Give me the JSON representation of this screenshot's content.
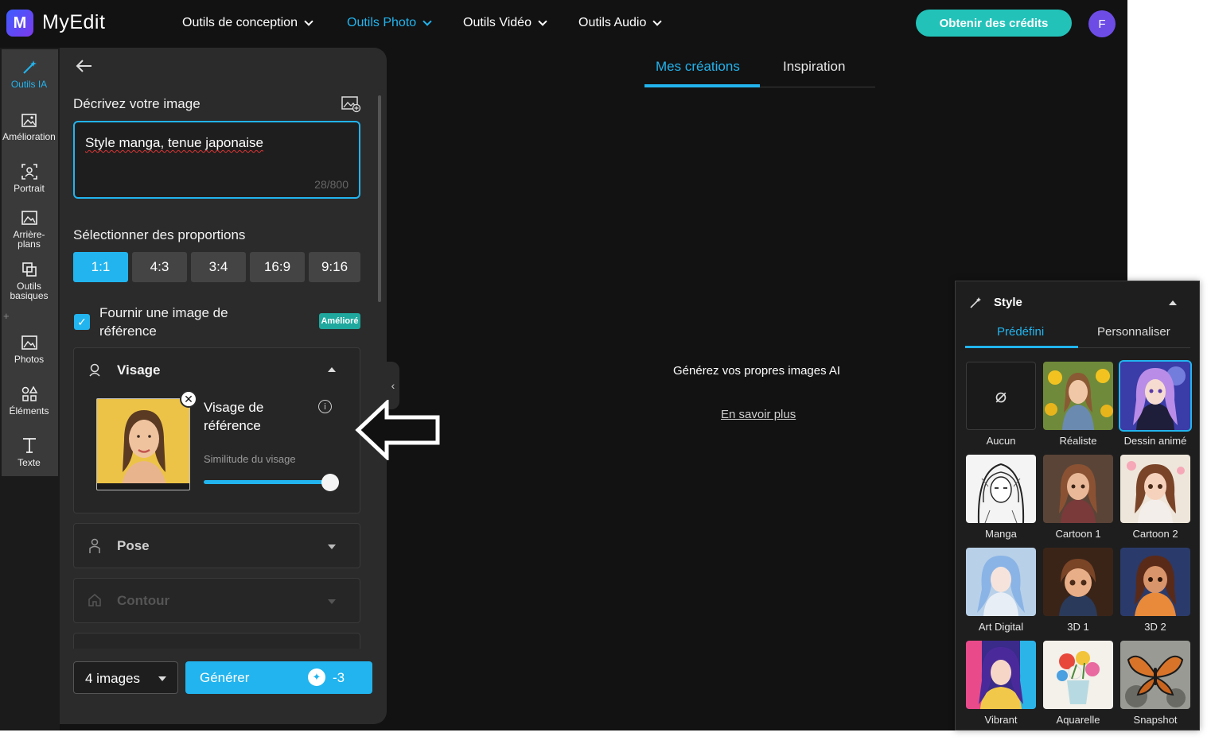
{
  "app": {
    "name": "MyEdit",
    "logo_letter": "M"
  },
  "nav": [
    {
      "label": "Outils de conception"
    },
    {
      "label": "Outils Photo"
    },
    {
      "label": "Outils Vidéo"
    },
    {
      "label": "Outils Audio"
    }
  ],
  "header": {
    "credits_button": "Obtenir des crédits",
    "avatar_letter": "F"
  },
  "sidebar": {
    "items": [
      {
        "label": "Outils IA",
        "icon": "magic-wand-icon"
      },
      {
        "label": "Amélioration",
        "icon": "image-enhance-icon"
      },
      {
        "label": "Portrait",
        "icon": "portrait-icon"
      },
      {
        "label": "Arrière-plans",
        "icon": "background-icon"
      },
      {
        "label": "Outils basiques",
        "icon": "crop-icon"
      },
      {
        "label": "Photos",
        "icon": "photo-icon"
      },
      {
        "label": "Éléments",
        "icon": "elements-icon"
      },
      {
        "label": "Texte",
        "icon": "text-icon"
      }
    ]
  },
  "panel": {
    "describe_label": "Décrivez votre image",
    "prompt_value": "Style manga, tenue japonaise",
    "char_count": "28/800",
    "proportions_label": "Sélectionner des proportions",
    "ratios": [
      "1:1",
      "4:3",
      "3:4",
      "16:9",
      "9:16"
    ],
    "selected_ratio": "1:1",
    "reference_checkbox_label": "Fournir une image de référence",
    "reference_checked": true,
    "improved_badge": "Amélioré",
    "face_section": {
      "title": "Visage",
      "ref_title": "Visage de référence",
      "similarity_label": "Similitude du visage",
      "similarity_value": 0.9
    },
    "pose_section": {
      "title": "Pose"
    },
    "contour_section": {
      "title": "Contour"
    },
    "images_count": "4 images",
    "generate_button": "Générer",
    "generate_cost": "-3"
  },
  "main": {
    "tabs": [
      "Mes créations",
      "Inspiration"
    ],
    "active_tab": "Mes créations",
    "empty_message": "Générez vos propres images AI",
    "learn_more": "En savoir plus"
  },
  "style_panel": {
    "title": "Style",
    "tabs": [
      "Prédéfini",
      "Personnaliser"
    ],
    "active_tab": "Prédéfini",
    "styles": [
      {
        "label": "Aucun"
      },
      {
        "label": "Réaliste"
      },
      {
        "label": "Dessin animé"
      },
      {
        "label": "Manga"
      },
      {
        "label": "Cartoon 1"
      },
      {
        "label": "Cartoon 2"
      },
      {
        "label": "Art Digital"
      },
      {
        "label": "3D 1"
      },
      {
        "label": "3D 2"
      },
      {
        "label": "Vibrant"
      },
      {
        "label": "Aquarelle"
      },
      {
        "label": "Snapshot"
      }
    ],
    "selected_style": "Dessin animé"
  },
  "colors": {
    "accent": "#22b4ee",
    "credits": "#22c2b9",
    "badge": "#1fa89e",
    "avatar": "#6d4ce6",
    "background": "#121212",
    "panel": "#2b2b2b"
  }
}
